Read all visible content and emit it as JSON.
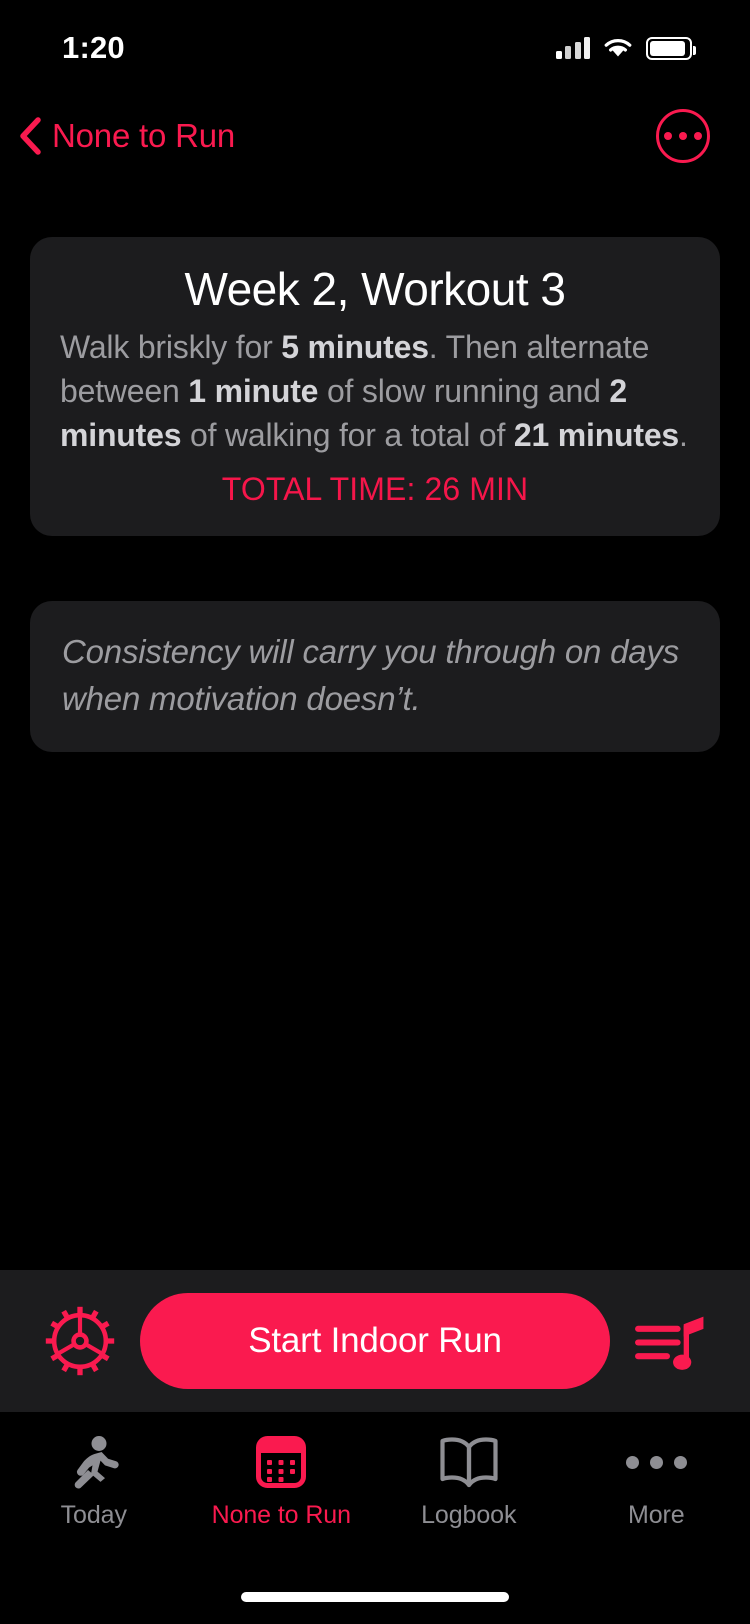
{
  "status_bar": {
    "time": "1:20",
    "signal_icon": "cellular-signal-icon",
    "wifi_icon": "wifi-icon",
    "battery_icon": "battery-icon"
  },
  "nav_bar": {
    "back_icon": "chevron-left-icon",
    "back_label": "None to Run",
    "more_icon": "ellipsis-circle-icon"
  },
  "workout_card": {
    "title": "Week 2, Workout 3",
    "desc_parts": [
      {
        "text": "Walk briskly for ",
        "bold": false
      },
      {
        "text": "5 minutes",
        "bold": true
      },
      {
        "text": ". Then alternate between ",
        "bold": false
      },
      {
        "text": "1 minute",
        "bold": true
      },
      {
        "text": " of slow running and ",
        "bold": false
      },
      {
        "text": "2 minutes",
        "bold": true
      },
      {
        "text": " of walking for a total of ",
        "bold": false
      },
      {
        "text": "21 minutes",
        "bold": true
      },
      {
        "text": ".",
        "bold": false
      }
    ],
    "total_time": "TOTAL TIME: 26 MIN"
  },
  "quote_card": {
    "text": "Consistency will carry you through on days when motivation doesn’t."
  },
  "action_bar": {
    "settings_icon": "gear-icon",
    "start_label": "Start Indoor Run",
    "music_icon": "music-playlist-icon"
  },
  "tab_bar": {
    "tabs": [
      {
        "label": "Today",
        "icon": "running-person-icon",
        "active": false
      },
      {
        "label": "None to Run",
        "icon": "calendar-icon",
        "active": true
      },
      {
        "label": "Logbook",
        "icon": "open-book-icon",
        "active": false
      },
      {
        "label": "More",
        "icon": "ellipsis-icon",
        "active": false
      }
    ]
  },
  "colors": {
    "accent": "#FA1A4F",
    "total_time": "#F5164A",
    "card_bg": "#1C1C1E",
    "screen_bg": "#000000",
    "muted_text": "#9C9CA0",
    "inactive_tab": "#8E8E93"
  }
}
